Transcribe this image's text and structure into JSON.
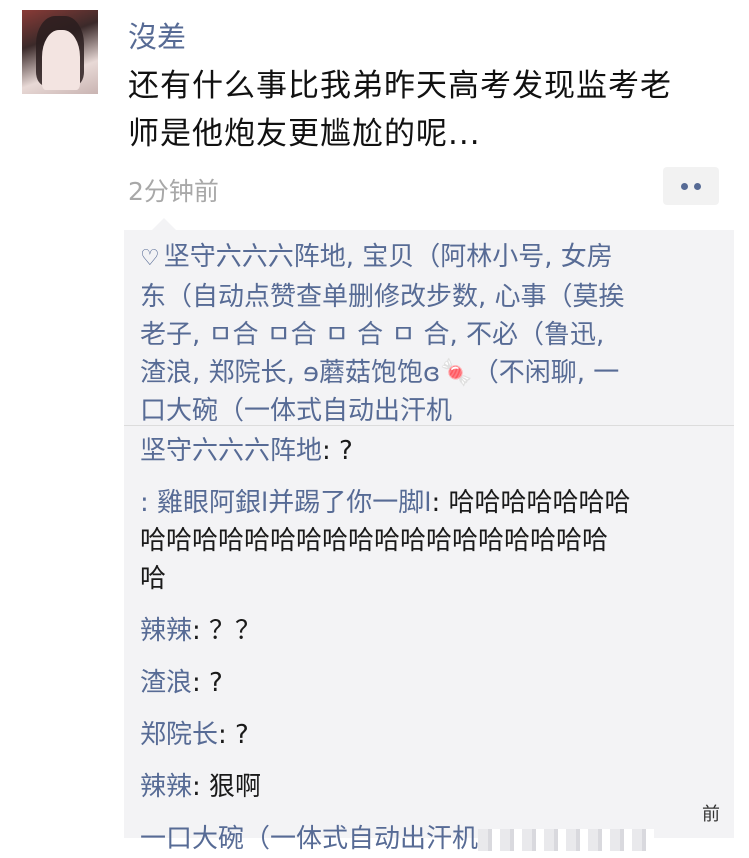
{
  "post": {
    "username": "沒差",
    "lines": [
      "还有什么事比我弟昨天高考发现监考老",
      "师是他炮友更尴尬的呢..."
    ],
    "time": "2分钟前"
  },
  "likes": {
    "icon": "heart-outline-icon",
    "lines": [
      "坚守六六六阵地, 宝贝（阿林小号, 女房",
      "东（自动点赞查单删修改步数, 心事（莫挨",
      "老子, ㅁ合  ㅁ合  ㅁ 合  ㅁ 合, 不必（鲁迅,",
      "渣浪, 郑院长, ɘ蘑菇饱饱ɞ🍬（不闲聊, 一",
      "口大碗（一体式自动出汗机"
    ]
  },
  "comments": [
    {
      "name": "坚守六六六阵地",
      "text": ": ?"
    },
    {
      "name": ":  雞眼阿銀l并踢了你一脚l",
      "text": ": 哈哈哈哈哈哈哈",
      "text2": "哈哈哈哈哈哈哈哈哈哈哈哈哈哈哈哈哈哈",
      "text3": "哈"
    },
    {
      "name": "辣辣",
      "text": ": ？？"
    },
    {
      "name": "渣浪",
      "text": ": ?"
    },
    {
      "name": "郑院长",
      "text": ": ?"
    },
    {
      "name": "辣辣",
      "text": ": 狠啊"
    },
    {
      "name": "一口大碗（一体式自动出汗机",
      "text": ""
    }
  ],
  "tail_text": "前",
  "colors": {
    "link": "#576b95",
    "box": "#f3f3f5",
    "time": "#a8a8a8"
  }
}
